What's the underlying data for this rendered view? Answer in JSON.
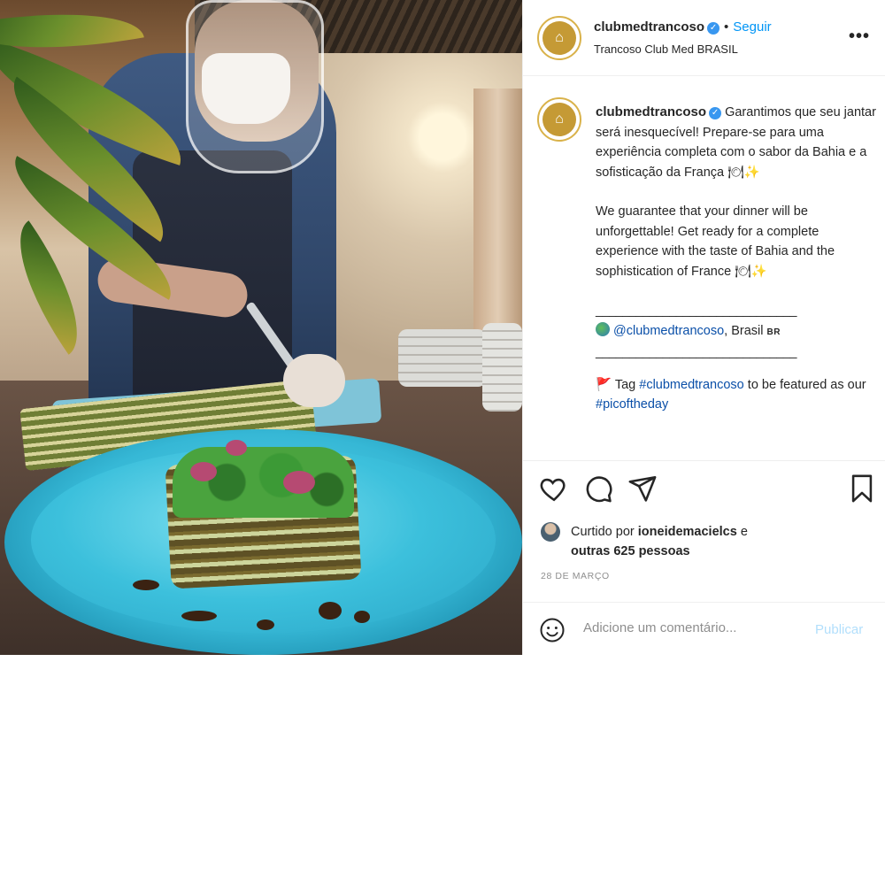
{
  "post": {
    "username": "clubmedtrancoso",
    "verified_badge": "✓",
    "follow_separator": "•",
    "follow_label": "Seguir",
    "location": "Trancoso Club Med BRASIL",
    "more_icon": "•••"
  },
  "caption": {
    "username": "clubmedtrancoso",
    "pt_text": "Garantimos que seu jantar será inesquecível! Prepare-se para uma experiência completa com o sabor da Bahia e a sofisticação da França 🍽✨",
    "en_text": "We guarantee that your dinner will be unforgettable! Get ready for a complete experience with the taste of Bahia and the sophistication of France 🍽✨",
    "separator": "______________________________",
    "mention": "@clubmedtrancoso",
    "location_text": ", Brasil",
    "country_code": "BR",
    "tag_prefix": "Tag",
    "tag_hashtag": "#clubmedtrancoso",
    "tag_mid": "to be featured as our",
    "tag_hashtag2": "#picoftheday"
  },
  "likes": {
    "prefix": "Curtido por",
    "user": "ioneidemacielcs",
    "and": "e",
    "others": "outras 625 pessoas"
  },
  "date": "28 de março",
  "comment": {
    "placeholder": "Adicione um comentário...",
    "publish_label": "Publicar"
  },
  "icons": [
    "heart-icon",
    "comment-icon",
    "share-icon",
    "bookmark-icon",
    "emoji-icon"
  ],
  "colors": {
    "link": "#0a4fa8",
    "follow": "#0095f6",
    "publish_disabled": "#b2dffc",
    "muted": "#8e8e8e",
    "verified": "#3897f0"
  }
}
